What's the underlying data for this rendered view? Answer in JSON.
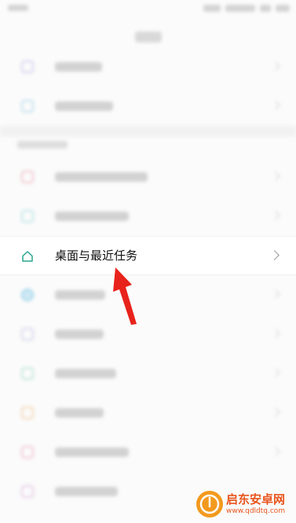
{
  "focus_row": {
    "icon": "home-icon",
    "label": "桌面与最近任务",
    "chevron": "chevron-right-icon"
  },
  "annotation": {
    "arrow_color": "#e8231b"
  },
  "watermark": {
    "brand": "启东安卓网",
    "url": "www.qdldtq.com",
    "logo_color": "#f39a1e"
  }
}
